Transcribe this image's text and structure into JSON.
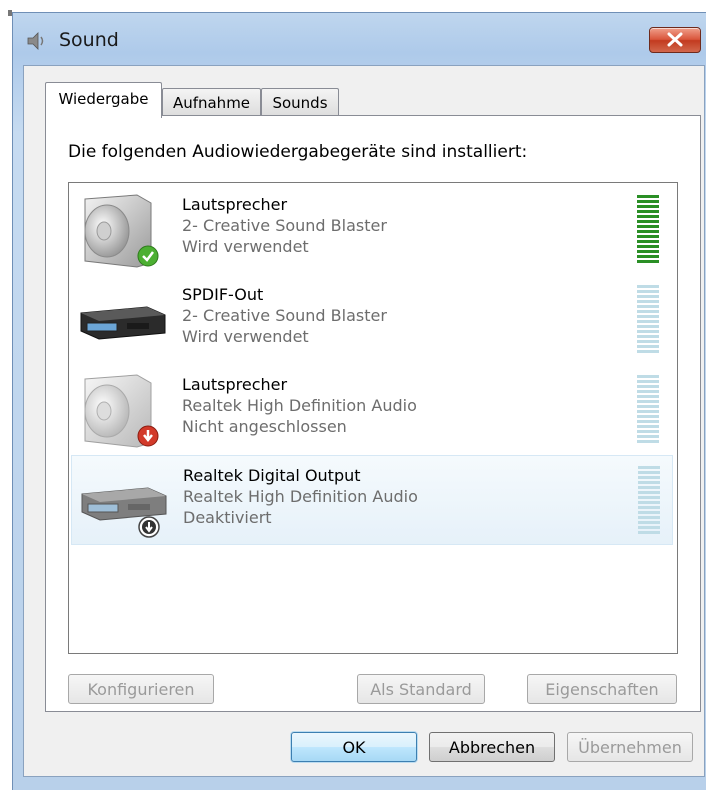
{
  "window": {
    "title": "Sound"
  },
  "tabs": [
    {
      "label": "Wiedergabe",
      "active": true
    },
    {
      "label": "Aufnahme",
      "active": false
    },
    {
      "label": "Sounds",
      "active": false
    }
  ],
  "playback": {
    "caption": "Die folgenden Audiowiedergabegeräte sind installiert:",
    "devices": [
      {
        "name": "Lautsprecher",
        "driver": "2- Creative Sound Blaster",
        "status": "Wird verwendet",
        "icon": "speaker-icon",
        "badge": "default-check-icon",
        "level": 1.0
      },
      {
        "name": "SPDIF-Out",
        "driver": "2- Creative Sound Blaster",
        "status": "Wird verwendet",
        "icon": "digital-output-icon",
        "badge": "",
        "level": 0.0
      },
      {
        "name": "Lautsprecher",
        "driver": "Realtek High Definition Audio",
        "status": "Nicht angeschlossen",
        "icon": "speaker-icon",
        "badge": "unplugged-icon",
        "level": 0.0
      },
      {
        "name": "Realtek Digital Output",
        "driver": "Realtek High Definition Audio",
        "status": "Deaktiviert",
        "icon": "digital-output-icon",
        "badge": "disabled-icon",
        "level": 0.0,
        "selected": true
      }
    ]
  },
  "buttons": {
    "configure": "Konfigurieren",
    "set_default": "Als Standard",
    "properties": "Eigenschaften",
    "ok": "OK",
    "cancel": "Abbrechen",
    "apply": "Übernehmen"
  },
  "colors": {
    "meter_active": "#2a8f25",
    "meter_inactive": "#bfdce6",
    "selected_row": "#e6f1f9",
    "close_button": "#d9543a"
  }
}
